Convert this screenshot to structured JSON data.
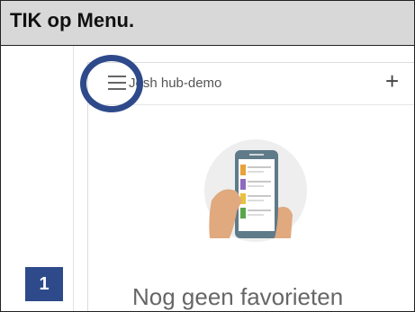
{
  "instruction": "TIK op Menu.",
  "app": {
    "hub_name": "Josh hub-demo",
    "add_symbol": "+"
  },
  "empty_state": {
    "message": "Nog geen favorieten"
  },
  "step": {
    "number": "1"
  },
  "colors": {
    "accent": "#2e4a8a",
    "banner": "#d8d8d8"
  },
  "icons": [
    "menu-icon",
    "plus-icon"
  ]
}
